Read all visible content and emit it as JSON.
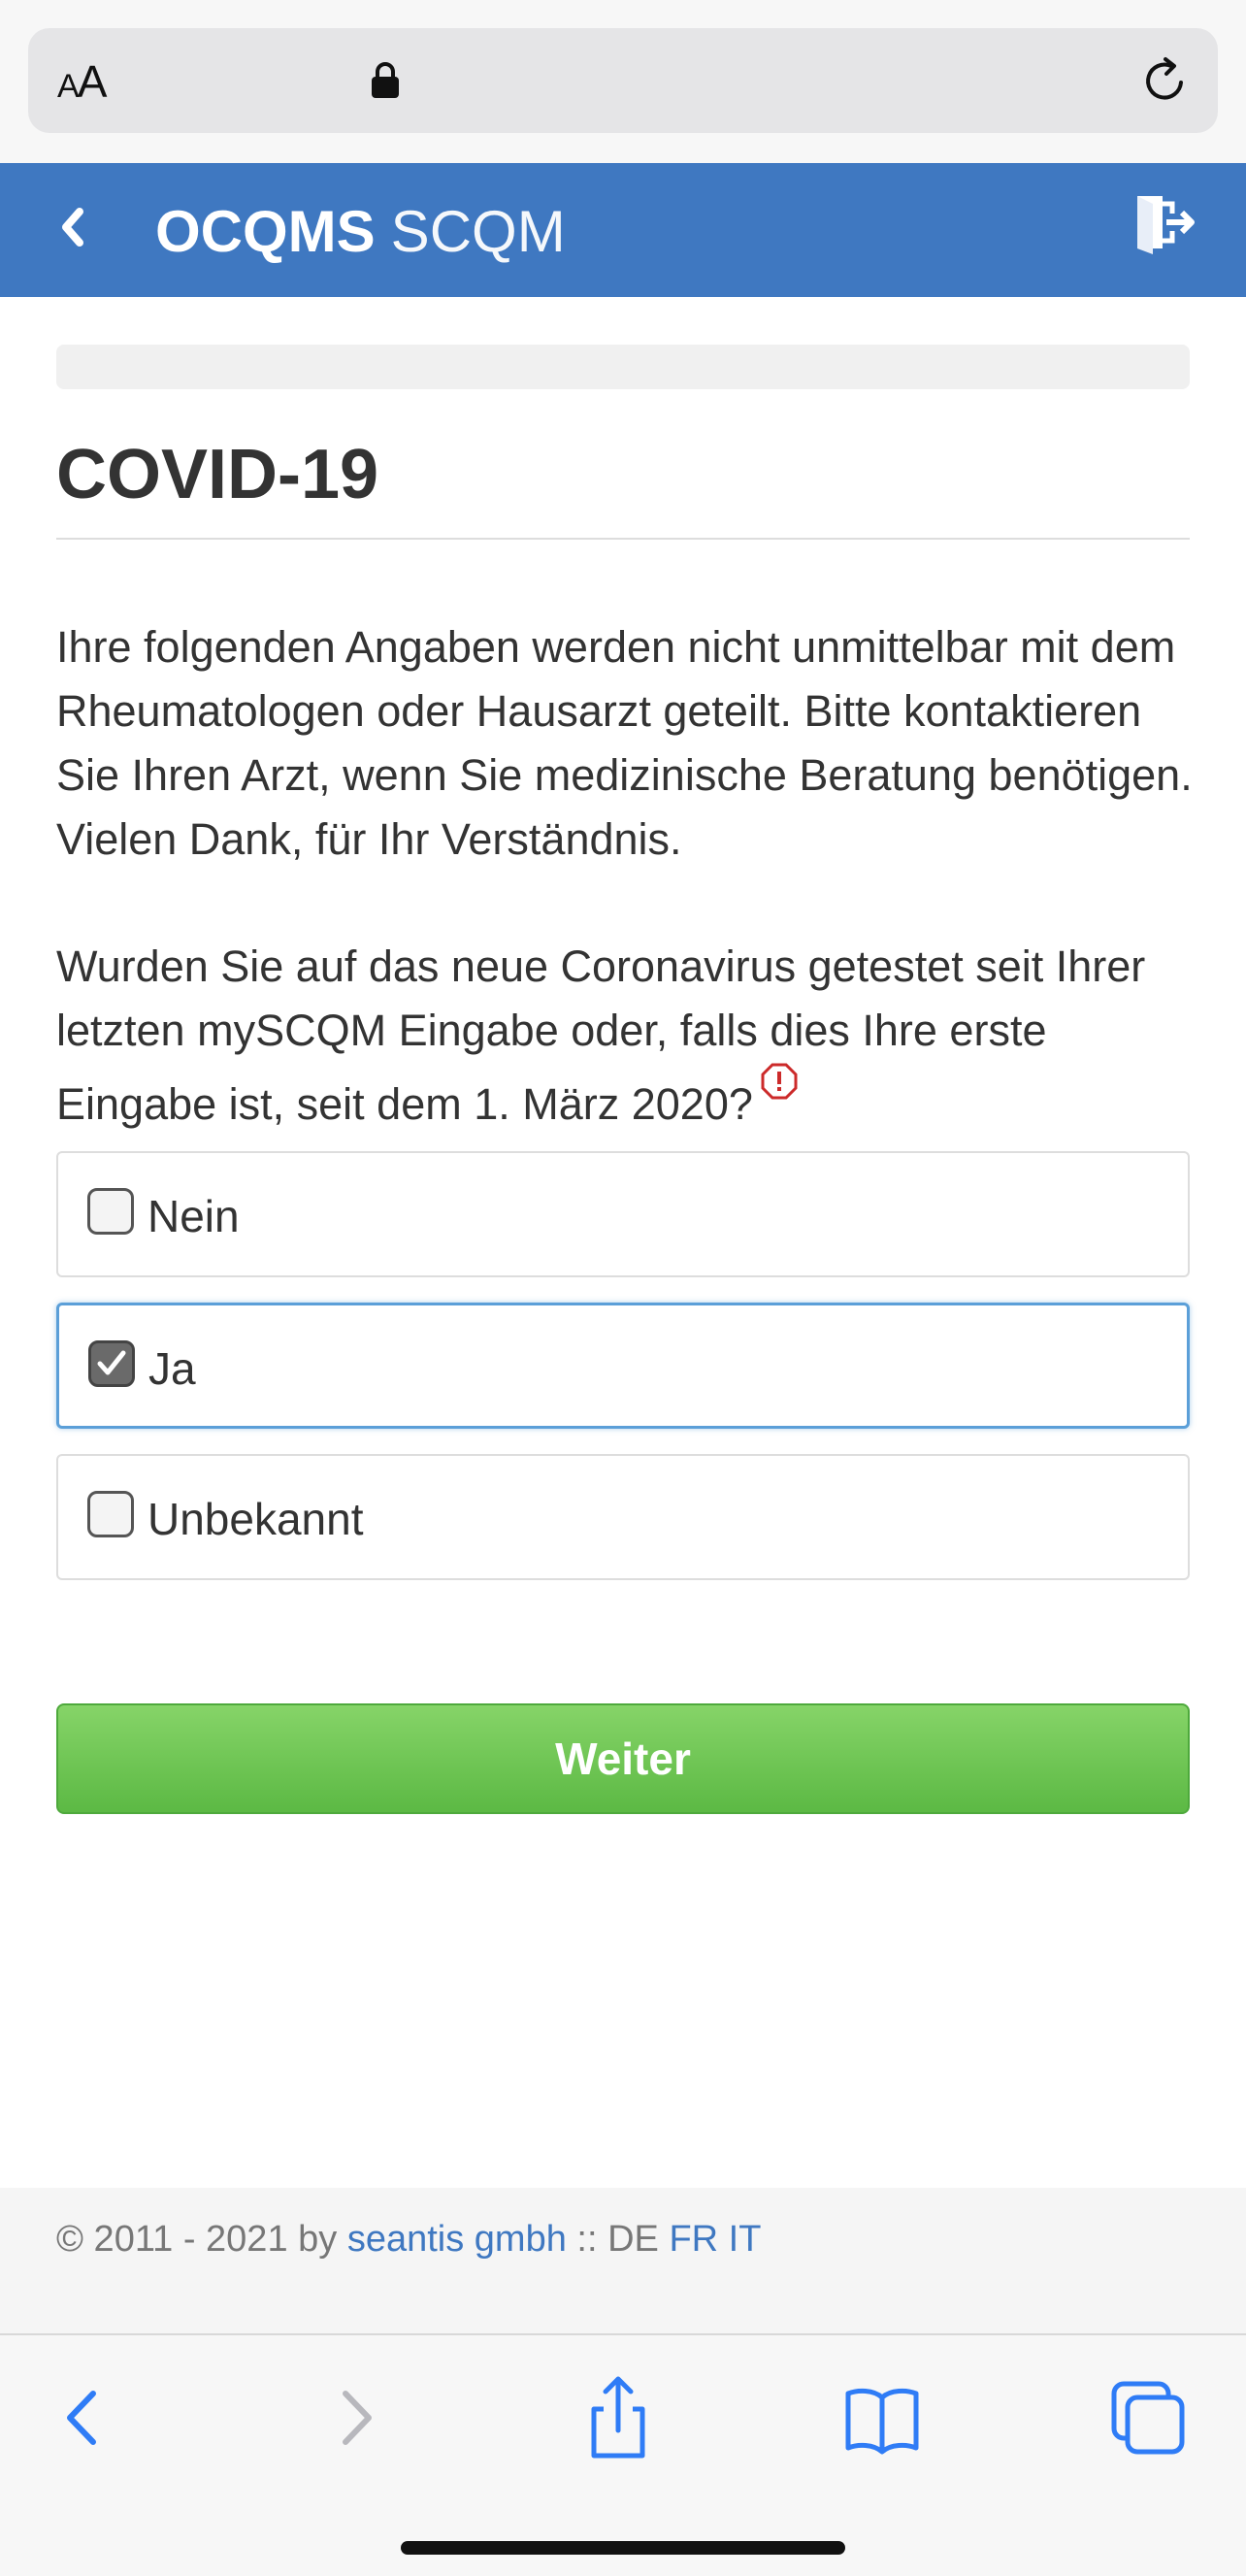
{
  "browser": {
    "text_size_label_small": "A",
    "text_size_label_large": "A"
  },
  "header": {
    "brand_bold": "OCQMS",
    "brand_light": "SCQM"
  },
  "page": {
    "title": "COVID-19",
    "intro": "Ihre folgenden Angaben werden nicht unmittelbar mit dem Rheumatologen oder Hausarzt geteilt. Bitte kontaktieren Sie Ihren Arzt, wenn Sie medizinische Beratung benötigen. Vielen Dank, für Ihr Verständnis.",
    "question": "Wurden Sie auf das neue Coronavirus getestet seit Ihrer letzten mySCQM Eingabe oder, falls dies Ihre erste Eingabe ist, seit dem 1. März 2020?",
    "options": [
      {
        "label": "Nein",
        "checked": false
      },
      {
        "label": "Ja",
        "checked": true
      },
      {
        "label": "Unbekannt",
        "checked": false
      }
    ],
    "submit_label": "Weiter"
  },
  "footer": {
    "copyright": "© 2011 - 2021 by",
    "company": "seantis gmbh",
    "separator": " :: ",
    "lang_current": "DE",
    "lang_fr": "FR",
    "lang_it": "IT"
  },
  "colors": {
    "header_bg": "#3f78c1",
    "submit_bg": "#5cb944",
    "link": "#3f78c1",
    "required": "#cc2a2a"
  }
}
